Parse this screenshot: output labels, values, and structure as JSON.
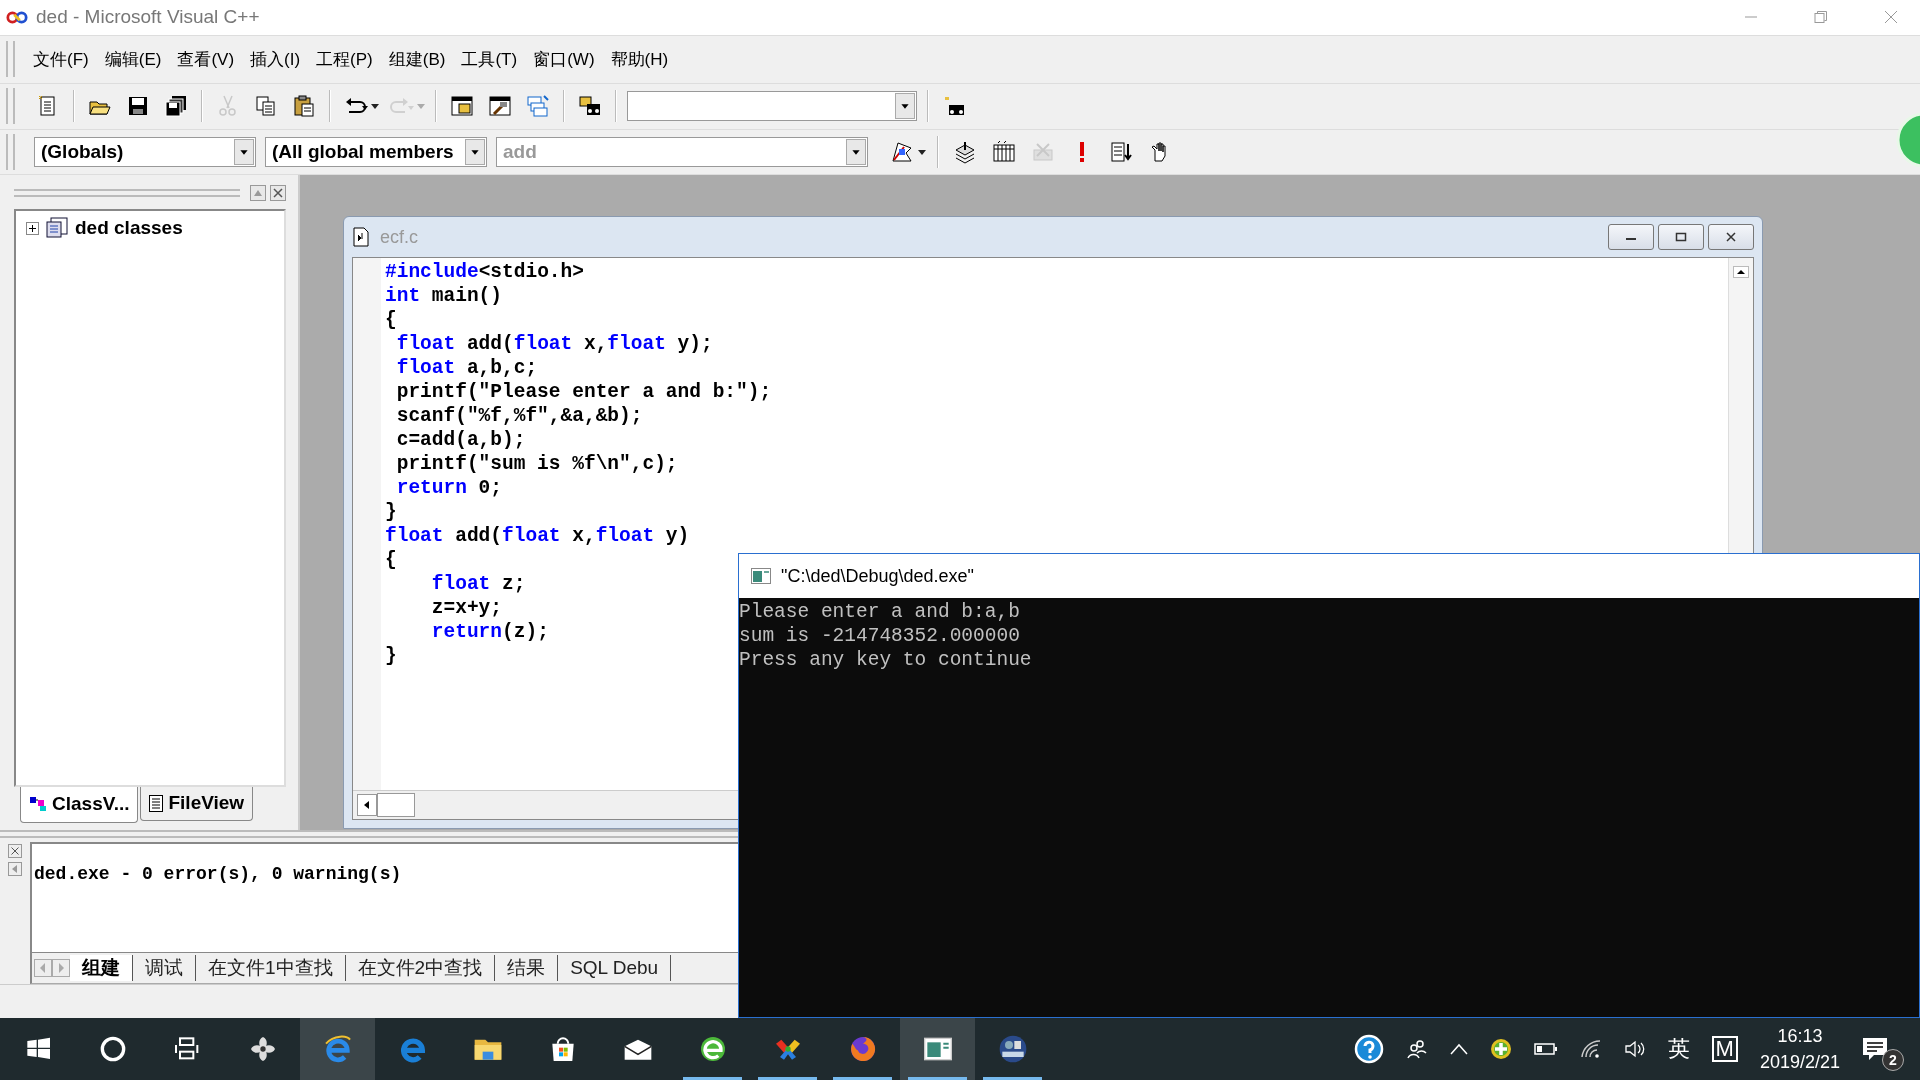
{
  "window": {
    "title": "ded - Microsoft Visual C++"
  },
  "menu": [
    "文件(F)",
    "编辑(E)",
    "查看(V)",
    "插入(I)",
    "工程(P)",
    "组建(B)",
    "工具(T)",
    "窗口(W)",
    "帮助(H)"
  ],
  "toolbar": {
    "buttons": [
      {
        "disabled": false
      },
      {
        "disabled": false
      },
      {
        "disabled": false
      },
      {
        "disabled": false
      },
      {
        "disabled": true
      },
      {
        "disabled": false
      },
      {
        "disabled": false
      },
      {
        "disabled": false
      },
      {
        "disabled": true
      },
      {
        "disabled": false
      },
      {
        "disabled": false
      },
      {
        "disabled": false
      },
      {
        "disabled": false
      },
      {
        "disabled": false
      }
    ]
  },
  "wizard_bar": {
    "class_combo": "(Globals)",
    "members_combo": "(All global members",
    "function_combo": {
      "value": "add",
      "disabled": true
    },
    "buttons": [
      {
        "disabled": false
      },
      {
        "disabled": false
      },
      {
        "disabled": false
      },
      {
        "disabled": true
      },
      {
        "disabled": false
      },
      {
        "disabled": false
      },
      {
        "disabled": false
      }
    ]
  },
  "workspace": {
    "tree": [
      {
        "label": "ded classes",
        "expanded": false
      }
    ],
    "tabs": [
      {
        "label": "ClassV...",
        "selected": true
      },
      {
        "label": "FileView",
        "selected": false
      }
    ]
  },
  "editor": {
    "title": "ecf.c",
    "lines": [
      [
        {
          "text": "#include",
          "kind": "keyword"
        },
        {
          "text": "<stdio.h>",
          "kind": "plain"
        }
      ],
      [
        {
          "text": "int",
          "kind": "keyword"
        },
        {
          "text": " main()",
          "kind": "plain"
        }
      ],
      [
        {
          "text": "{",
          "kind": "plain"
        }
      ],
      [
        {
          "text": " float",
          "kind": "keyword"
        },
        {
          "text": " add(",
          "kind": "plain"
        },
        {
          "text": "float",
          "kind": "keyword"
        },
        {
          "text": " x,",
          "kind": "plain"
        },
        {
          "text": "float",
          "kind": "keyword"
        },
        {
          "text": " y);",
          "kind": "plain"
        }
      ],
      [
        {
          "text": " float",
          "kind": "keyword"
        },
        {
          "text": " a,b,c;",
          "kind": "plain"
        }
      ],
      [
        {
          "text": " printf(\"Please enter a and b:\");",
          "kind": "plain"
        }
      ],
      [
        {
          "text": " scanf(\"%f,%f\",&a,&b);",
          "kind": "plain"
        }
      ],
      [
        {
          "text": " c=add(a,b);",
          "kind": "plain"
        }
      ],
      [
        {
          "text": " printf(\"sum is %f\\n\",c);",
          "kind": "plain"
        }
      ],
      [
        {
          "text": " return",
          "kind": "keyword"
        },
        {
          "text": " 0;",
          "kind": "plain"
        }
      ],
      [
        {
          "text": "}",
          "kind": "plain"
        }
      ],
      [
        {
          "text": "float",
          "kind": "keyword"
        },
        {
          "text": " add(",
          "kind": "plain"
        },
        {
          "text": "float",
          "kind": "keyword"
        },
        {
          "text": " x,",
          "kind": "plain"
        },
        {
          "text": "float",
          "kind": "keyword"
        },
        {
          "text": " y)",
          "kind": "plain"
        }
      ],
      [
        {
          "text": "{",
          "kind": "plain"
        }
      ],
      [
        {
          "text": "    float",
          "kind": "keyword"
        },
        {
          "text": " z;",
          "kind": "plain"
        }
      ],
      [
        {
          "text": "    z=x+y;",
          "kind": "plain"
        }
      ],
      [
        {
          "text": "    return",
          "kind": "keyword"
        },
        {
          "text": "(z);",
          "kind": "plain"
        }
      ],
      [
        {
          "text": "}",
          "kind": "plain"
        }
      ]
    ]
  },
  "output": {
    "lines": [
      "ded.exe - 0 error(s), 0 warning(s)"
    ],
    "tabs": [
      {
        "label": "组建",
        "selected": true
      },
      {
        "label": "调试",
        "selected": false
      },
      {
        "label": "在文件1中查找",
        "selected": false
      },
      {
        "label": "在文件2中查找",
        "selected": false
      },
      {
        "label": "结果",
        "selected": false
      },
      {
        "label": "SQL Debu",
        "selected": false
      }
    ]
  },
  "console": {
    "title": "\"C:\\ded\\Debug\\ded.exe\"",
    "lines": [
      "Please enter a and b:a,b",
      "sum is -214748352.000000",
      "Press any key to continue"
    ]
  },
  "taskbar": {
    "items": [
      {
        "selected": false,
        "running": false
      },
      {
        "selected": false,
        "running": false
      },
      {
        "selected": false,
        "running": false
      },
      {
        "selected": false,
        "running": false
      },
      {
        "selected": true,
        "running": false
      },
      {
        "selected": false,
        "running": false
      },
      {
        "selected": false,
        "running": false
      },
      {
        "selected": false,
        "running": false
      },
      {
        "selected": false,
        "running": false
      },
      {
        "selected": false,
        "running": true
      },
      {
        "selected": false,
        "running": true
      },
      {
        "selected": false,
        "running": true
      },
      {
        "selected": true,
        "running": true
      },
      {
        "selected": false,
        "running": true
      }
    ],
    "tray": {
      "ime": "英",
      "ime_mode": "M",
      "time": "16:13",
      "date": "2019/2/21",
      "notifications": "2"
    }
  }
}
